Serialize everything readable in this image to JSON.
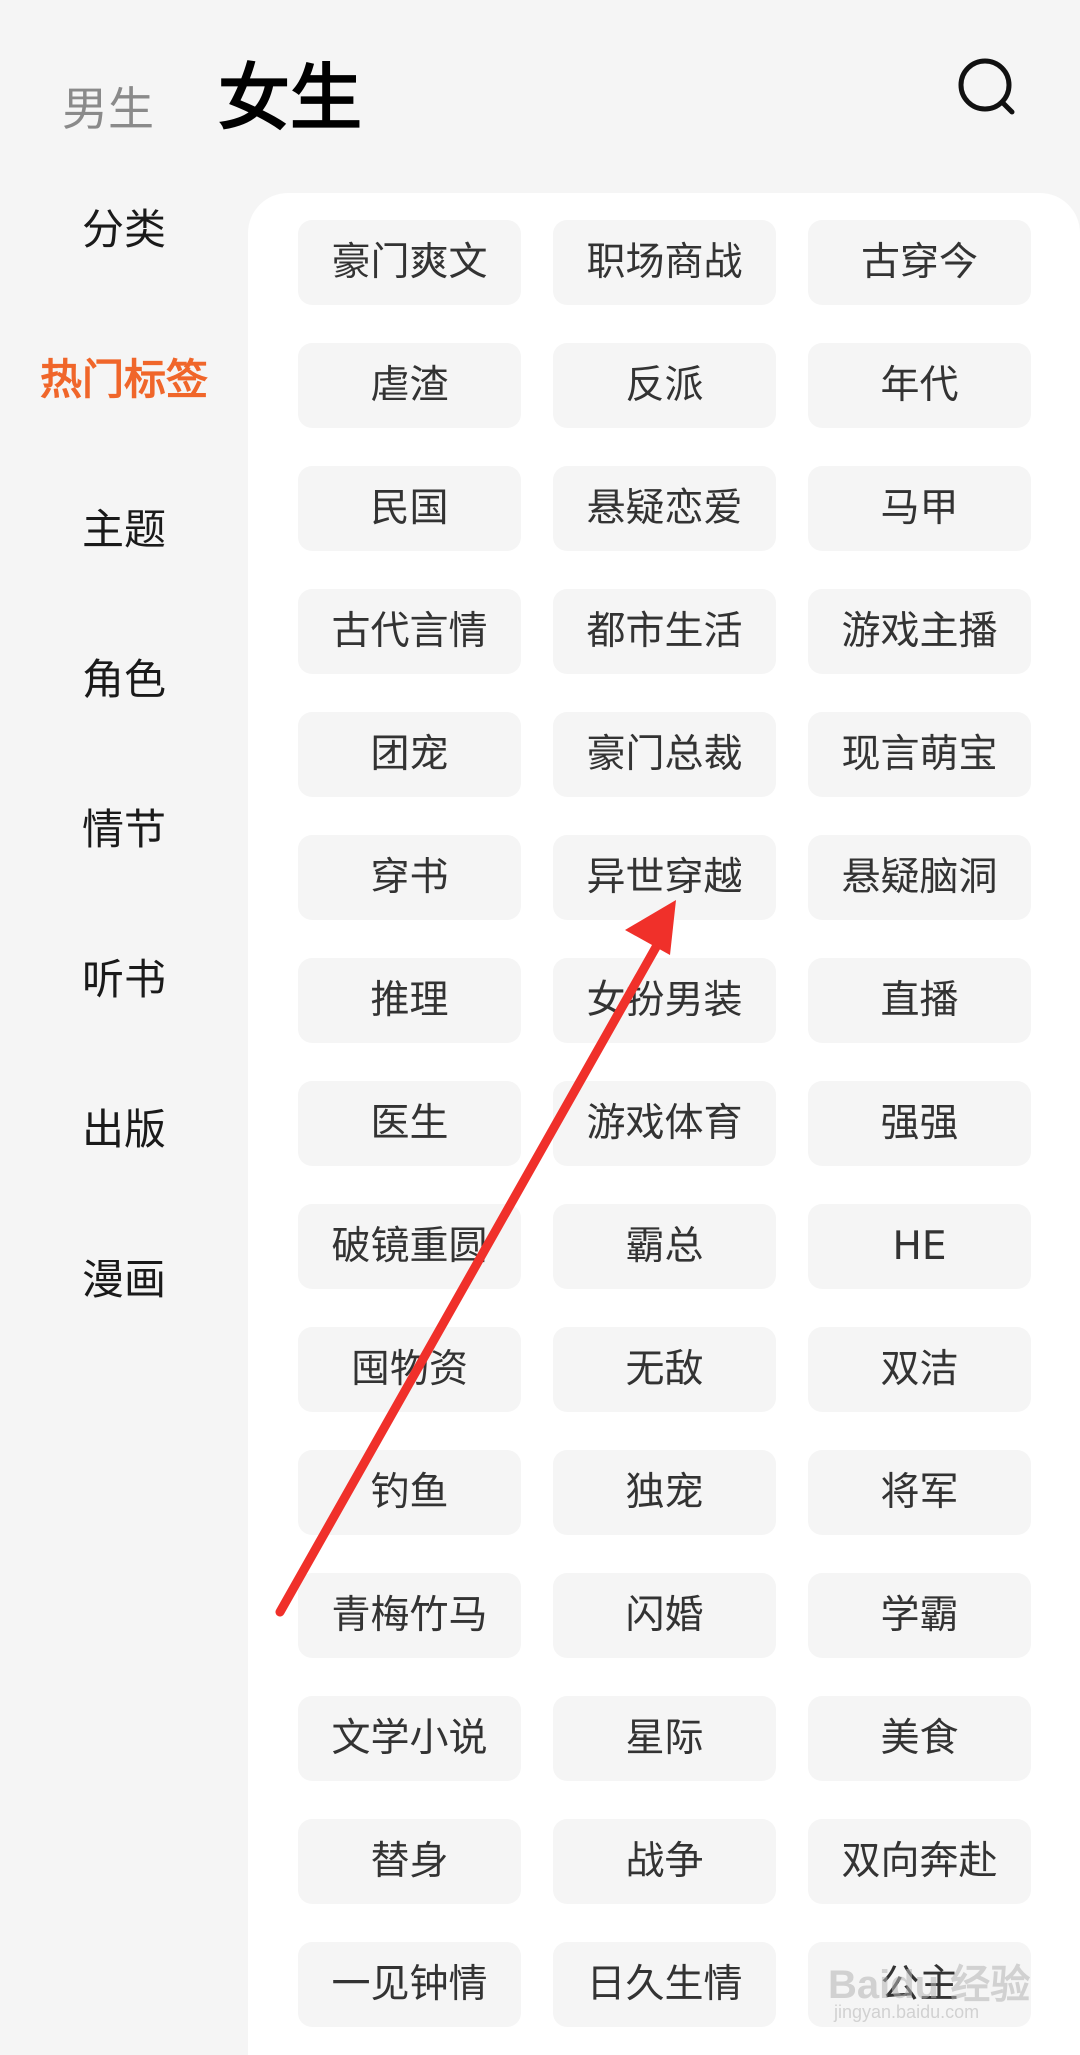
{
  "header": {
    "tab_male": "男生",
    "tab_female": "女生",
    "search_icon": "search-icon"
  },
  "sidebar": {
    "items": [
      {
        "label": "分类",
        "active": false
      },
      {
        "label": "热门标签",
        "active": true
      },
      {
        "label": "主题",
        "active": false
      },
      {
        "label": "角色",
        "active": false
      },
      {
        "label": "情节",
        "active": false
      },
      {
        "label": "听书",
        "active": false
      },
      {
        "label": "出版",
        "active": false
      },
      {
        "label": "漫画",
        "active": false
      }
    ]
  },
  "tags": [
    "豪门爽文",
    "职场商战",
    "古穿今",
    "虐渣",
    "反派",
    "年代",
    "民国",
    "悬疑恋爱",
    "马甲",
    "古代言情",
    "都市生活",
    "游戏主播",
    "团宠",
    "豪门总裁",
    "现言萌宝",
    "穿书",
    "异世穿越",
    "悬疑脑洞",
    "推理",
    "女扮男装",
    "直播",
    "医生",
    "游戏体育",
    "强强",
    "破镜重圆",
    "霸总",
    "HE",
    "囤物资",
    "无敌",
    "双洁",
    "钓鱼",
    "独宠",
    "将军",
    "青梅竹马",
    "闪婚",
    "学霸",
    "文学小说",
    "星际",
    "美食",
    "替身",
    "战争",
    "双向奔赴",
    "一见钟情",
    "日久生情",
    "公主"
  ],
  "annotation": {
    "type": "red-arrow",
    "points_to": "异世穿越",
    "color": "#f0302a"
  },
  "watermark": {
    "text": "Baidu 经验",
    "sub": "jingyan.baidu.com"
  },
  "colors": {
    "accent": "#f0662a",
    "page_bg": "#f5f5f5",
    "panel_bg": "#ffffff",
    "tag_bg": "#f5f5f5",
    "tag_text": "#333333",
    "inactive_tab": "#8a8a8a"
  }
}
